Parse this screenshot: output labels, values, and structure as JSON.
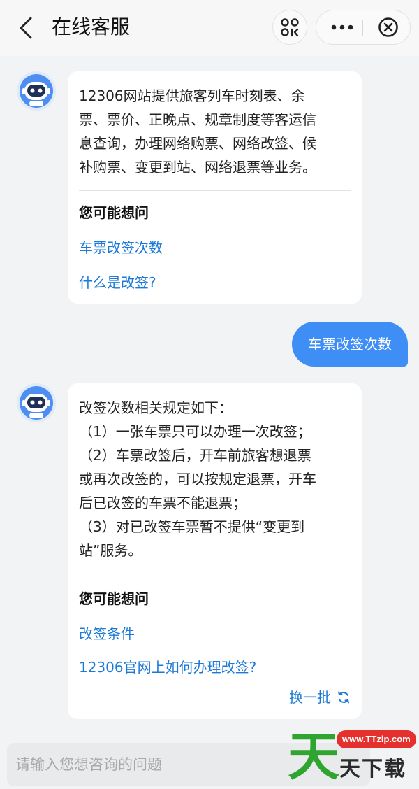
{
  "header": {
    "title": "在线客服",
    "icons": [
      "back-arrow-icon",
      "scan-icon",
      "more-icon",
      "close-circle-icon"
    ]
  },
  "messages": [
    {
      "from": "bot",
      "text": "12306网站提供旅客列车时刻表、余\n票、票价、正晚点、规章制度等客运信\n息查询，办理网络购票、网络改签、候\n补购票、变更到站、网络退票等业务。",
      "suggest_title": "您可能想问",
      "suggestions": [
        "车票改签次数",
        "什么是改签?"
      ]
    },
    {
      "from": "user",
      "text": "车票改签次数"
    },
    {
      "from": "bot",
      "text": "改签次数相关规定如下：\n（1）一张车票只可以办理一次改签；\n（2）车票改签后，开车前旅客想退票\n或再次改签的，可以按规定退票，开车\n后已改签的车票不能退票；\n（3）对已改签车票暂不提供“变更到\n站”服务。",
      "suggest_title": "您可能想问",
      "suggestions": [
        "改签条件",
        "12306官网上如何办理改签?"
      ],
      "refresh_label": "换一批"
    }
  ],
  "input": {
    "placeholder": "请输入您想咨询的问题",
    "value": ""
  },
  "watermark": {
    "logo_char": "天",
    "url": "www.TTzip.com",
    "text": "天下载"
  },
  "colors": {
    "link": "#1c79d6",
    "user_bubble": "#3f8ef6",
    "background": "#f2f3f5"
  }
}
